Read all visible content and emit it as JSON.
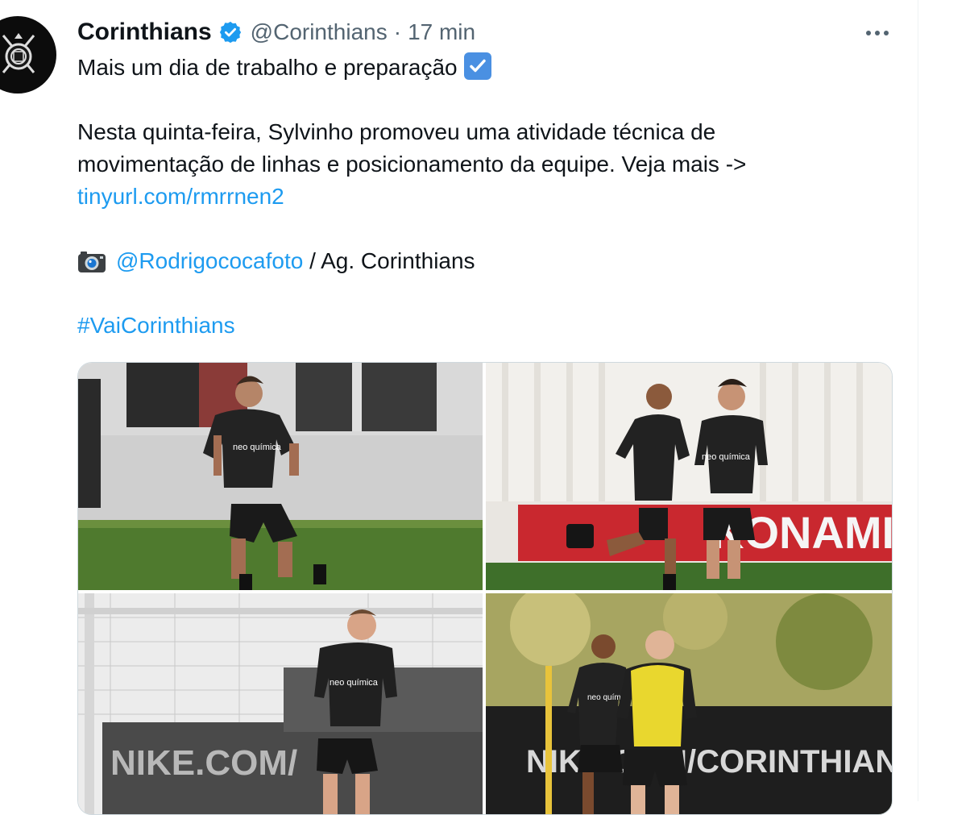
{
  "tweet": {
    "author_name": "Corinthians",
    "handle": "@Corinthians",
    "separator": "·",
    "time": "17 min",
    "lines": {
      "l1": "Mais um dia de trabalho e preparação",
      "l2": "Nesta quinta-feira, Sylvinho promoveu uma atividade técnica de",
      "l3": "movimentação de linhas e posicionamento da equipe. Veja mais ->",
      "link": "tinyurl.com/rmrrnen2",
      "mention": "@Rodrigococafoto",
      "credit": " / Ag. Corinthians",
      "hashtag": "#VaiCorinthians"
    },
    "photos": [
      {
        "jersey_sponsor": "neo química",
        "banner": ""
      },
      {
        "jersey_sponsor": "neo química",
        "banner": "KONAMI"
      },
      {
        "jersey_sponsor": "neo química",
        "banner": "NIKE.COM/"
      },
      {
        "jersey_sponsor": "neo química",
        "banner": "NIKE.COM/CORINTHIANS"
      }
    ]
  },
  "icons": {
    "avatar": "corinthians-crest-icon",
    "verified": "verified-badge-icon",
    "check": "check-box-emoji-icon",
    "camera": "camera-emoji-icon",
    "more": "more-options-icon"
  },
  "colors": {
    "link": "#1d9bf0",
    "secondary_text": "#536471",
    "verified": "#1d9bf0"
  }
}
